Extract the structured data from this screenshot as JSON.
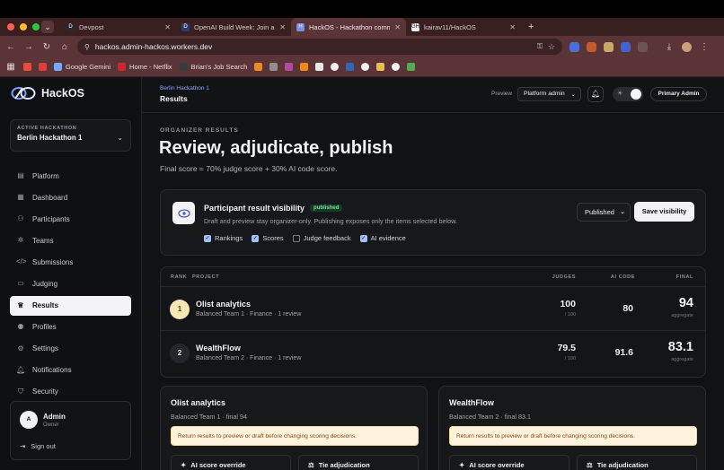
{
  "browser": {
    "tabs": [
      {
        "favicon": "D",
        "title": "Devpost",
        "active": false
      },
      {
        "favicon": "D",
        "title": "OpenAI Build Week: Join a gl",
        "active": false
      },
      {
        "favicon": "H",
        "title": "HackOS - Hackathon comma",
        "active": true
      },
      {
        "favicon": "GH",
        "title": "kairav11/HackOS",
        "active": false
      }
    ],
    "url": "hackos.admin-hackos.workers.dev",
    "bookmarks": [
      "Google Gemini",
      "Home - Netflix",
      "Brian's Job Search"
    ]
  },
  "sidebar": {
    "app_name": "HackOS",
    "hackathon_label": "ACTIVE HACKATHON",
    "hackathon_value": "Berlin Hackathon 1",
    "items": [
      {
        "label": "Platform",
        "icon": "platform-icon"
      },
      {
        "label": "Dashboard",
        "icon": "dashboard-icon"
      },
      {
        "label": "Participants",
        "icon": "participants-icon"
      },
      {
        "label": "Teams",
        "icon": "teams-icon"
      },
      {
        "label": "Submissions",
        "icon": "code-icon"
      },
      {
        "label": "Judging",
        "icon": "clipboard-icon"
      },
      {
        "label": "Results",
        "icon": "trophy-icon"
      },
      {
        "label": "Profiles",
        "icon": "profiles-icon"
      },
      {
        "label": "Settings",
        "icon": "settings-icon"
      },
      {
        "label": "Notifications",
        "icon": "bell-icon"
      },
      {
        "label": "Security",
        "icon": "shield-icon"
      }
    ],
    "active_item": "Results",
    "user": {
      "initial": "A",
      "name": "Admin",
      "role": "Owner",
      "signout": "Sign out"
    }
  },
  "header": {
    "breadcrumb": "Berlin Hackathon 1",
    "title": "Results",
    "preview_label": "Preview",
    "preview_value": "Platform admin",
    "user_pill": "Primary Admin"
  },
  "page": {
    "eyebrow": "ORGANIZER RESULTS",
    "title": "Review, adjudicate, publish",
    "subtitle": "Final score = 70% judge score + 30% AI code score."
  },
  "visibility": {
    "title": "Participant result visibility",
    "badge": "published",
    "description": "Draft and preview stay organizer-only. Publishing exposes only the items selected below.",
    "options": [
      {
        "label": "Rankings",
        "checked": true
      },
      {
        "label": "Scores",
        "checked": true
      },
      {
        "label": "Judge feedback",
        "checked": false
      },
      {
        "label": "AI evidence",
        "checked": true
      }
    ],
    "select_value": "Published",
    "save_label": "Save visibility"
  },
  "results_table": {
    "headers": {
      "rank": "RANK",
      "project": "PROJECT",
      "judges": "JUDGES",
      "ai_code": "AI CODE",
      "final": "FINAL"
    },
    "rows": [
      {
        "rank": "1",
        "project": "Olist analytics",
        "meta": "Balanced Team 1 · Finance · 1 review",
        "judges": "100",
        "judges_sub": "/ 100",
        "ai_code": "80",
        "final": "94",
        "final_sub": "aggregate"
      },
      {
        "rank": "2",
        "project": "WealthFlow",
        "meta": "Balanced Team 2 · Finance · 1 review",
        "judges": "79.5",
        "judges_sub": "/ 100",
        "ai_code": "91.6",
        "final": "83.1",
        "final_sub": "aggregate"
      }
    ]
  },
  "cards": [
    {
      "title": "Olist analytics",
      "subtitle": "Balanced Team 1 · final 94",
      "warning": "Return results to preview or draft before changing scoring decisions.",
      "btn1": "AI score override",
      "btn2": "Tie adjudication"
    },
    {
      "title": "WealthFlow",
      "subtitle": "Balanced Team 2 · final 83.1",
      "warning": "Return results to preview or draft before changing scoring decisions.",
      "btn1": "AI score override",
      "btn2": "Tie adjudication"
    }
  ],
  "colors": {
    "accent": "#8ea3ff",
    "published_badge": "#6ee29a",
    "warning_bg": "#fdf3dc",
    "rank_gold": "#f7e8b5"
  }
}
